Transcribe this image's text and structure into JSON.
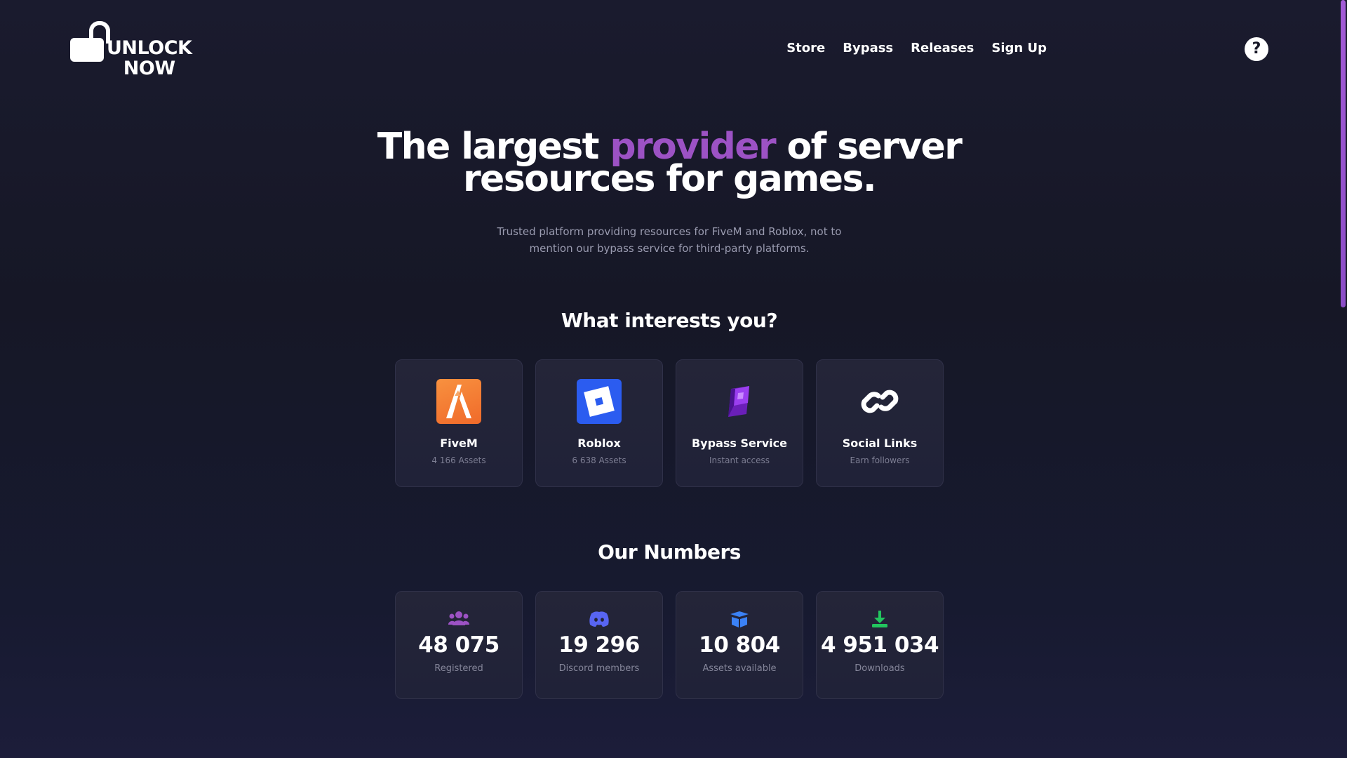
{
  "header": {
    "logo_line1": "UNLOCK",
    "logo_line2": "NOW",
    "nav": [
      "Store",
      "Bypass",
      "Releases",
      "Sign Up"
    ],
    "help_label": "?"
  },
  "hero": {
    "title_before": "The largest ",
    "title_accent": "provider",
    "title_after_line1": " of server",
    "title_line2": "resources for games.",
    "subtitle_line1": "Trusted platform providing resources for FiveM and Roblox, not to",
    "subtitle_line2": "mention our bypass service for third-party platforms."
  },
  "interests": {
    "title": "What interests you?",
    "cards": [
      {
        "label": "FiveM",
        "sub": "4 166 Assets",
        "icon": "fivem-icon"
      },
      {
        "label": "Roblox",
        "sub": "6 638 Assets",
        "icon": "roblox-icon"
      },
      {
        "label": "Bypass Service",
        "sub": "Instant access",
        "icon": "bypass-cube-icon"
      },
      {
        "label": "Social Links",
        "sub": "Earn followers",
        "icon": "link-icon"
      }
    ]
  },
  "numbers": {
    "title": "Our Numbers",
    "stats": [
      {
        "value": "48 075",
        "label": "Registered",
        "icon": "users-icon",
        "color": "#9c52c4"
      },
      {
        "value": "19 296",
        "label": "Discord members",
        "icon": "discord-icon",
        "color": "#5865f2"
      },
      {
        "value": "10 804",
        "label": "Assets available",
        "icon": "box-icon",
        "color": "#3b82f6"
      },
      {
        "value": "4 951 034",
        "label": "Downloads",
        "icon": "download-icon",
        "color": "#22c55e"
      }
    ]
  },
  "colors": {
    "accent": "#9c52c4",
    "background": "#161726",
    "card": "#242538"
  }
}
